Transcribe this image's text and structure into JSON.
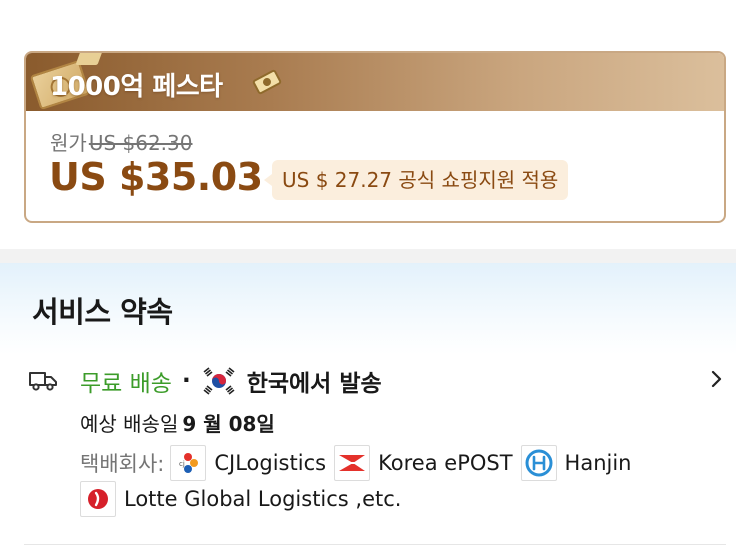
{
  "promo": {
    "title": "1000억 페스타",
    "original_label": "원가",
    "original_price": "US $62.30",
    "sale_price": "US $35.03",
    "subsidy_text": "US $ 27.27 공식 쇼핑지원 적용"
  },
  "service": {
    "section_title": "서비스 약속",
    "free_shipping": "무료 배송",
    "separator": "·",
    "origin": "한국에서 발송",
    "estimate_label": "예상 배송일",
    "estimate_date": "9 월 08일",
    "carrier_label": "택배회사:",
    "carriers": [
      {
        "name": "CJLogistics",
        "icon": "cj-logistics-logo-icon"
      },
      {
        "name": "Korea ePOST",
        "icon": "korea-epost-logo-icon"
      },
      {
        "name": "Hanjin",
        "icon": "hanjin-logo-icon"
      },
      {
        "name": "Lotte Global Logistics ,etc.",
        "icon": "lotte-logo-icon"
      }
    ]
  },
  "colors": {
    "price_brown": "#8a4a12",
    "free_shipping_green": "#3c9c2a",
    "promo_border": "#c9a884",
    "subsidy_bg": "#fbeedd"
  },
  "icons": [
    "money-decoration-icon",
    "banknote-icon",
    "truck-icon",
    "south-korea-flag-icon",
    "chevron-right-icon"
  ]
}
